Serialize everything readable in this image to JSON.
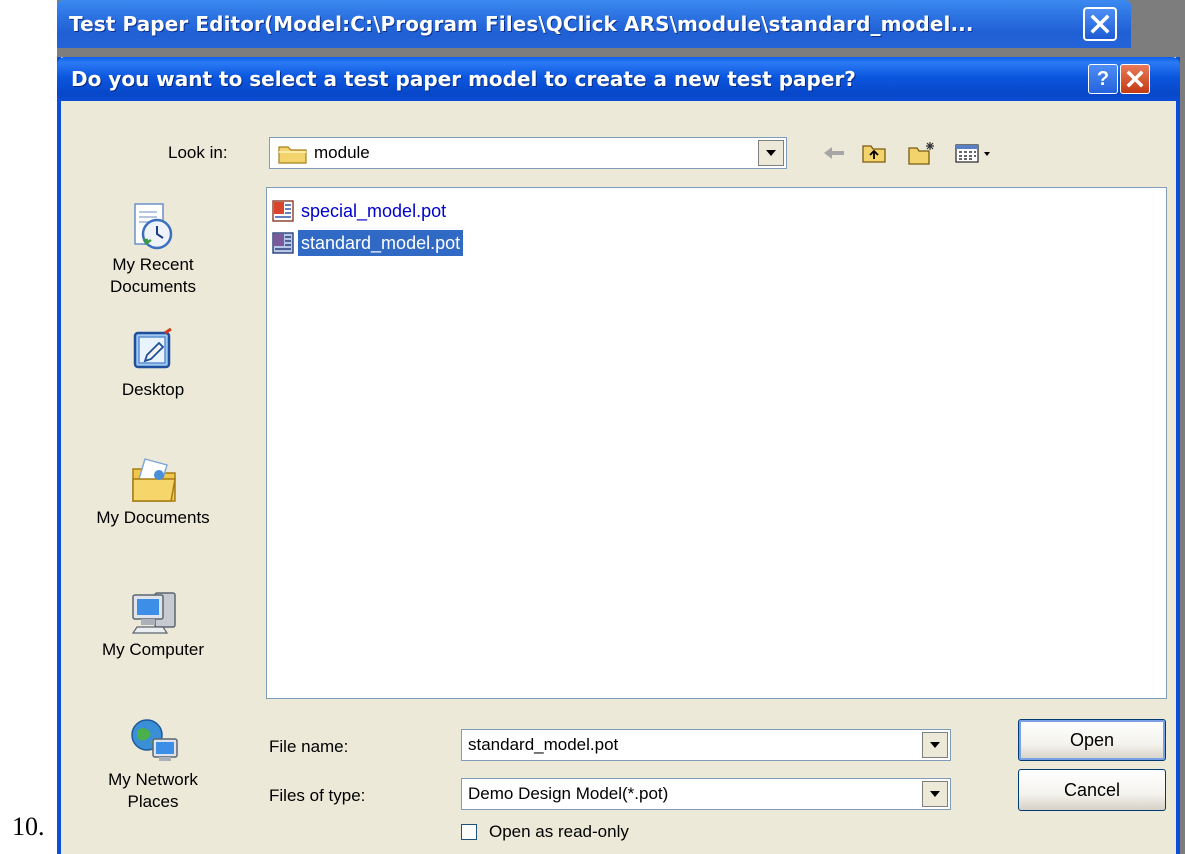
{
  "list_number": "10.",
  "parent_window": {
    "title": "Test Paper Editor(Model:C:\\Program Files\\QClick ARS\\module\\standard_model...",
    "close_glyph": "✕"
  },
  "dialog": {
    "title": "Do you want to select a test paper model to create a new test paper?",
    "help_glyph": "?",
    "close_glyph": "✕",
    "look_in": {
      "label": "Look in:",
      "value": "module"
    },
    "toolbar": {
      "back_icon": "back-arrow-icon",
      "up_icon": "up-folder-icon",
      "new_folder_icon": "new-folder-icon",
      "views_icon": "views-menu-icon"
    },
    "places": [
      {
        "label": "My Recent Documents",
        "icon": "recent-documents-icon"
      },
      {
        "label": "Desktop",
        "icon": "desktop-icon"
      },
      {
        "label": "My Documents",
        "icon": "my-documents-icon"
      },
      {
        "label": "My Computer",
        "icon": "my-computer-icon"
      },
      {
        "label": "My Network Places",
        "icon": "network-places-icon"
      }
    ],
    "files": [
      {
        "name": "special_model.pot",
        "selected": false
      },
      {
        "name": "standard_model.pot",
        "selected": true
      }
    ],
    "file_name": {
      "label": "File name:",
      "value": "standard_model.pot"
    },
    "file_type": {
      "label": "Files of type:",
      "value": "Demo Design Model(*.pot)"
    },
    "open_label": "Open",
    "cancel_label": "Cancel",
    "read_only": {
      "label": "Open as read-only",
      "checked": false
    }
  },
  "colors": {
    "title_blue": "#0a4fd6",
    "dialog_face": "#ece9d8",
    "selection": "#316ac5",
    "link_blue": "#0000cc"
  }
}
